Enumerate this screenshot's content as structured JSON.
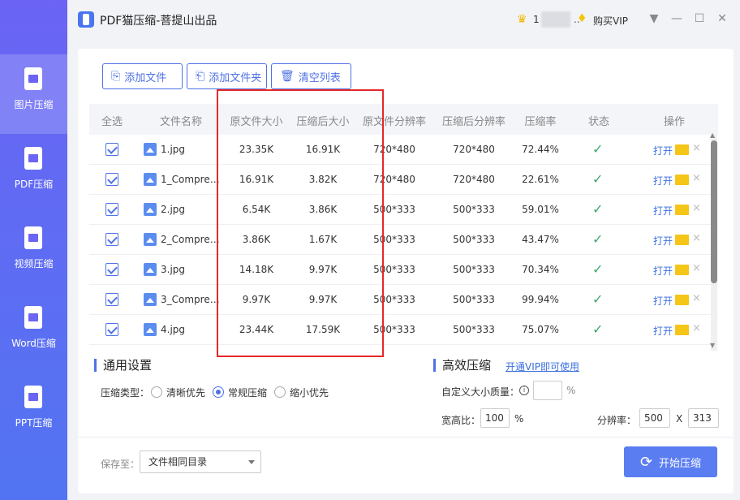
{
  "app": {
    "title": "PDF猫压缩-菩提山出品"
  },
  "user": {
    "name_prefix": "1",
    "dots": "..",
    "buy_vip": "购买VIP"
  },
  "window": {
    "menu": "▼",
    "minimize": "—",
    "maximize": "☐",
    "close": "✕"
  },
  "sidebar": {
    "items": [
      {
        "label": "图片压缩",
        "active": true
      },
      {
        "label": "PDF压缩"
      },
      {
        "label": "视频压缩"
      },
      {
        "label": "Word压缩"
      },
      {
        "label": "PPT压缩"
      }
    ]
  },
  "toolbar": {
    "add_file": "添加文件",
    "add_folder": "添加文件夹",
    "clear_list": "清空列表"
  },
  "table": {
    "headers": [
      "全选",
      "文件名称",
      "原文件大小",
      "压缩后大小",
      "原文件分辨率",
      "压缩后分辨率",
      "压缩率",
      "状态",
      "操作"
    ],
    "open_label": "打开",
    "rows": [
      {
        "name": "1.jpg",
        "orig_size": "23.35K",
        "comp_size": "16.91K",
        "orig_res": "720*480",
        "comp_res": "720*480",
        "rate": "72.44%"
      },
      {
        "name": "1_Compres...",
        "orig_size": "16.91K",
        "comp_size": "3.82K",
        "orig_res": "720*480",
        "comp_res": "720*480",
        "rate": "22.61%"
      },
      {
        "name": "2.jpg",
        "orig_size": "6.54K",
        "comp_size": "3.86K",
        "orig_res": "500*333",
        "comp_res": "500*333",
        "rate": "59.01%"
      },
      {
        "name": "2_Compres...",
        "orig_size": "3.86K",
        "comp_size": "1.67K",
        "orig_res": "500*333",
        "comp_res": "500*333",
        "rate": "43.47%"
      },
      {
        "name": "3.jpg",
        "orig_size": "14.18K",
        "comp_size": "9.97K",
        "orig_res": "500*333",
        "comp_res": "500*333",
        "rate": "70.34%"
      },
      {
        "name": "3_Compres...",
        "orig_size": "9.97K",
        "comp_size": "9.97K",
        "orig_res": "500*333",
        "comp_res": "500*333",
        "rate": "99.94%"
      },
      {
        "name": "4.jpg",
        "orig_size": "23.44K",
        "comp_size": "17.59K",
        "orig_res": "500*333",
        "comp_res": "500*333",
        "rate": "75.07%"
      }
    ]
  },
  "general_settings": {
    "title": "通用设置",
    "type_label": "压缩类型：",
    "options": [
      "清晰优先",
      "常规压缩",
      "缩小优先"
    ],
    "selected": "常规压缩"
  },
  "efficient": {
    "title": "高效压缩",
    "vip_link": "开通VIP即可使用",
    "quality_label": "自定义大小质量：",
    "quality_value": "",
    "percent": "%",
    "ratio_label": "宽高比：",
    "ratio_value": "100",
    "resolution_label": "分辨率：",
    "res_w": "500",
    "res_x": "X",
    "res_h": "313"
  },
  "footer": {
    "save_label": "保存至：",
    "save_value": "文件相同目录",
    "start_button": "开始压缩"
  },
  "colors": {
    "accent": "#4f72e5",
    "sidebar_top": "#6b64f4",
    "sidebar_bottom": "#5274f2",
    "highlight": "#e5282a",
    "success": "#3aa86a"
  }
}
